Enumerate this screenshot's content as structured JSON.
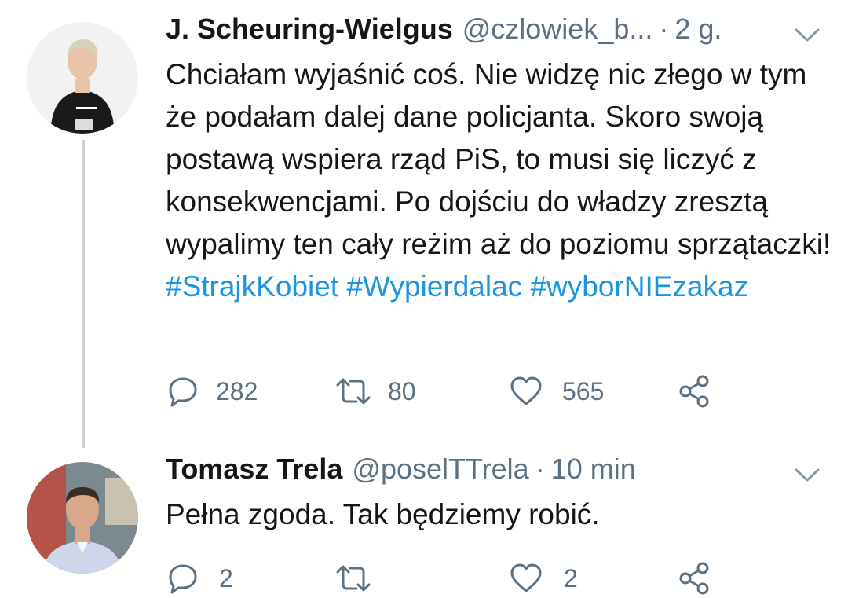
{
  "tweets": [
    {
      "name": "J. Scheuring-Wielgus",
      "handle": "@czlowiek_b...",
      "separator": "·",
      "time": "2 g.",
      "text_plain": "Chciałam wyjaśnić coś. Nie widzę nic złego w tym że podałam dalej dane policjanta. Skoro swoją postawą wspiera rząd PiS, to musi się liczyć z konsekwencjami. Po dojściu do władzy zresztą wypalimy ten cały reżim aż do poziomu sprzątaczki!",
      "hashtags": [
        "#StrajkKobiet",
        "#Wypierdalac",
        "#wyborNIEzakaz"
      ],
      "reply_count": "282",
      "retweet_count": "80",
      "like_count": "565"
    },
    {
      "name": "Tomasz Trela",
      "handle": "@poselTTrela",
      "separator": "·",
      "time": "10 min",
      "text_plain": "Pełna zgoda. Tak będziemy robić.",
      "reply_count": "2",
      "retweet_count": "",
      "like_count": "2"
    }
  ],
  "icons": {
    "reply": "reply-icon",
    "retweet": "retweet-icon",
    "like": "heart-icon",
    "share": "share-icon",
    "caret": "chevron-down-icon"
  },
  "colors": {
    "link": "#1b95e0",
    "secondary": "#5b7083",
    "thread_line": "#c9d2d8"
  }
}
